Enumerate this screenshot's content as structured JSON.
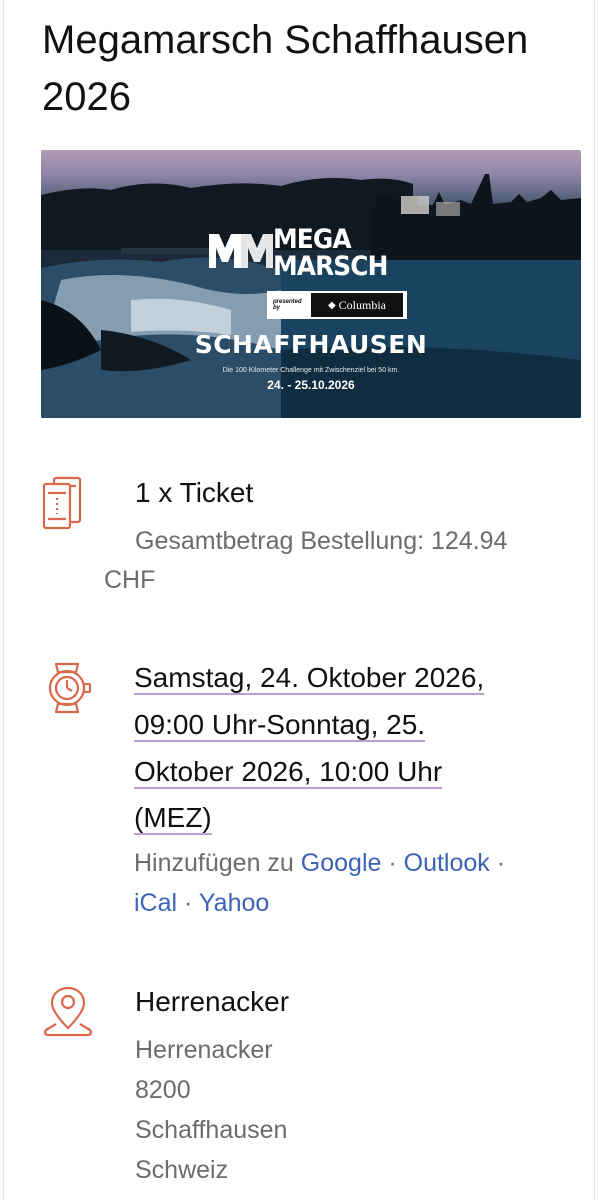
{
  "event": {
    "title_line1": "Megamarsch Schaffhausen",
    "title_line2": "2026"
  },
  "banner": {
    "logo_line1": "MEGA",
    "logo_line2": "MARSCH",
    "presented_by": "presented by",
    "sponsor": "Columbia",
    "city": "SCHAFFHAUSEN",
    "tagline": "Die 100 Kilometer Challenge mit Zwischenziel bei 50 km.",
    "dates": "24. - 25.10.2026"
  },
  "ticket": {
    "icon": "ticket-icon",
    "quantity_label": "1 x Ticket",
    "total_line1": "Gesamtbetrag Bestellung: 124.94",
    "total_line2": "CHF"
  },
  "datetime": {
    "icon": "watch-icon",
    "line1": "Samstag, 24. Oktober 2026,",
    "line2": "09:00 Uhr-Sonntag, 25.",
    "line3": "Oktober 2026, 10:00 Uhr",
    "line4": "(MEZ)",
    "add_to": "Hinzufügen zu",
    "separator": "·",
    "calendars": [
      "Google",
      "Outlook",
      "iCal",
      "Yahoo"
    ]
  },
  "location": {
    "icon": "location-pin-icon",
    "name": "Herrenacker",
    "address_lines": [
      "Herrenacker",
      "8200",
      "Schaffhausen",
      "Schweiz"
    ]
  },
  "colors": {
    "icon_accent": "#d9694a",
    "link_blue": "#3d63b6",
    "underline_purple": "#b99ed4"
  }
}
